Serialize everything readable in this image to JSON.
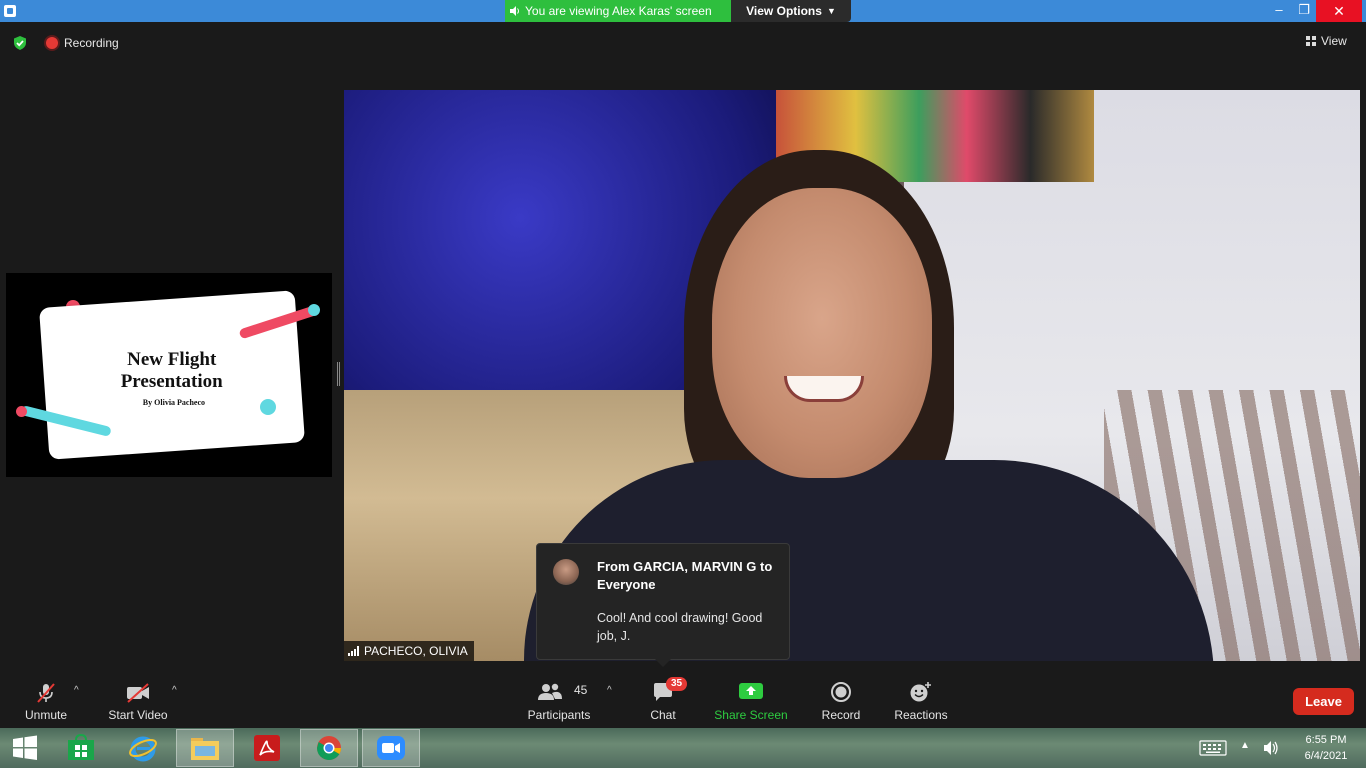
{
  "titlebar": {
    "viewing_text": "You are viewing Alex Karas' screen",
    "view_options_label": "View Options",
    "minimize": "–",
    "maximize": "❐",
    "close": "✕"
  },
  "topbar": {
    "recording_label": "Recording",
    "view_label": "View"
  },
  "shared_slide": {
    "title_line1": "New Flight",
    "title_line2": "Presentation",
    "byline": "By Olivia Pacheco"
  },
  "video": {
    "participant_name": "PACHECO, OLIVIA"
  },
  "chat_popup": {
    "from": "From GARCIA, MARVIN G to Everyone",
    "message": "Cool! And cool drawing! Good job, J."
  },
  "controls": {
    "unmute": "Unmute",
    "start_video": "Start Video",
    "participants": "Participants",
    "participants_count": "45",
    "chat": "Chat",
    "chat_badge": "35",
    "share_screen": "Share Screen",
    "record": "Record",
    "reactions": "Reactions",
    "leave": "Leave"
  },
  "taskbar": {
    "time": "6:55 PM",
    "date": "6/4/2021"
  },
  "colors": {
    "zoom_blue": "#3c8ad8",
    "banner_green": "#2ebf3e",
    "leave_red": "#d52b1e",
    "badge_red": "#e53935"
  }
}
